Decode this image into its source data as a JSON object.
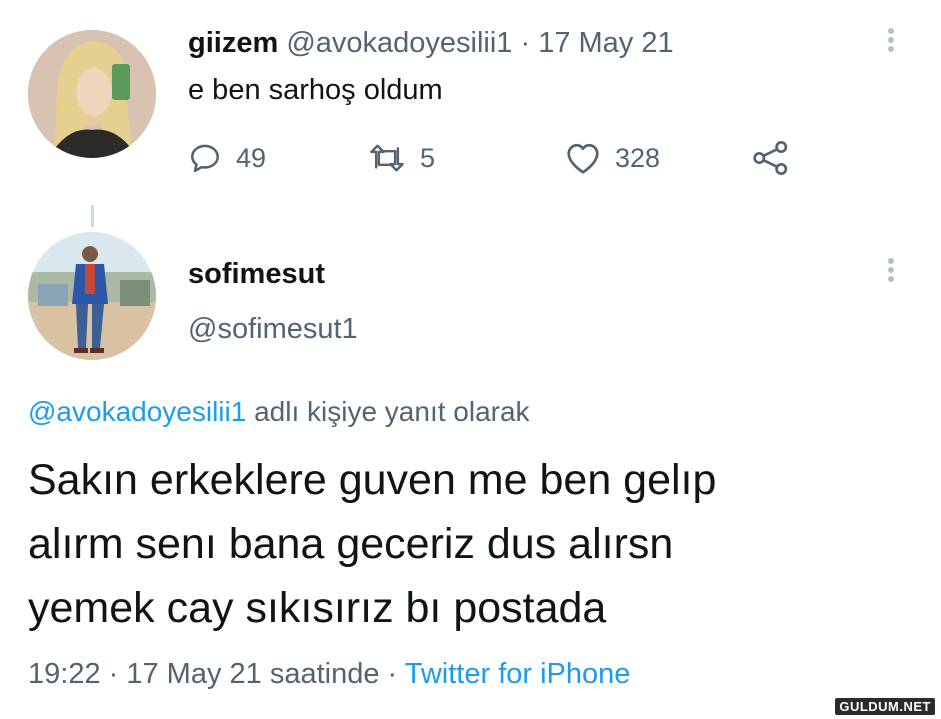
{
  "tweet1": {
    "display_name": "giizem",
    "handle": "@avokadoyesilii1",
    "separator": " · ",
    "date": "17 May 21",
    "text": "e ben sarhoş oldum",
    "actions": {
      "replies": "49",
      "retweets": "5",
      "likes": "328"
    },
    "icons": [
      "reply-icon",
      "retweet-icon",
      "like-icon",
      "share-icon",
      "more-icon"
    ]
  },
  "tweet2": {
    "display_name": "sofimesut",
    "handle": "@sofimesut1",
    "reply_to_mention": "@avokadoyesilii1",
    "reply_to_suffix": " adlı kişiye yanıt olarak",
    "text_lines": [
      "Sakın erkeklere guven me ben gelıp",
      "alırm senı bana geceriz dus alırsn",
      "yemek cay sıkısırız bı postada"
    ],
    "time": "19:22",
    "footer_separator": " · ",
    "date_suffix": "17 May 21 saatinde",
    "source": "Twitter for iPhone"
  },
  "watermark": "GULDUM.NET",
  "colors": {
    "text": "#0f1419",
    "secondary": "#536471",
    "link": "#1d9bf0",
    "divider": "#cfd9de"
  }
}
